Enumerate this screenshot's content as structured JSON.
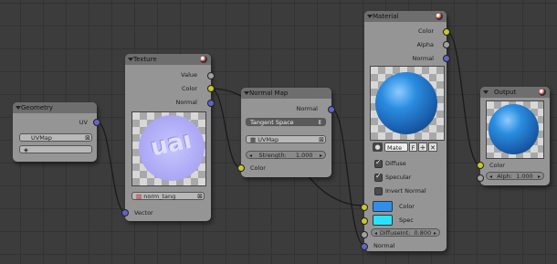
{
  "geometry": {
    "title": "Geometry",
    "out_uv": "UV",
    "uvmap": "UVMap"
  },
  "texture": {
    "title": "Texture",
    "out_value": "Value",
    "out_color": "Color",
    "out_normal": "Normal",
    "image_name": "norm_tang",
    "in_vector": "Vector",
    "preview_text": "uaı"
  },
  "normalmap": {
    "title": "Normal Map",
    "out_normal": "Normal",
    "space": "Tangent Space",
    "uvmap": "UVMap",
    "strength_label": "Strength:",
    "strength_value": "1.000",
    "in_color": "Color"
  },
  "material": {
    "title": "Material",
    "out_color": "Color",
    "out_alpha": "Alpha",
    "out_normal": "Normal",
    "mat_name": "Mate",
    "fake_user": "F",
    "diffuse": "Diffuse",
    "specular": "Specular",
    "invert_normal": "Invert Normal",
    "in_color": "Color",
    "in_spec": "Spec",
    "diffint_label": "DiffuseInt:",
    "diffint_value": "0.800",
    "in_normal": "Normal",
    "diffuse_checked": true,
    "specular_checked": true,
    "invert_checked": false,
    "color_hex": "#2f8fea",
    "spec_hex": "#27e3ff"
  },
  "output": {
    "title": "Output",
    "in_color": "Color",
    "alpha_label": "Alph:",
    "alpha_value": "1.000"
  }
}
